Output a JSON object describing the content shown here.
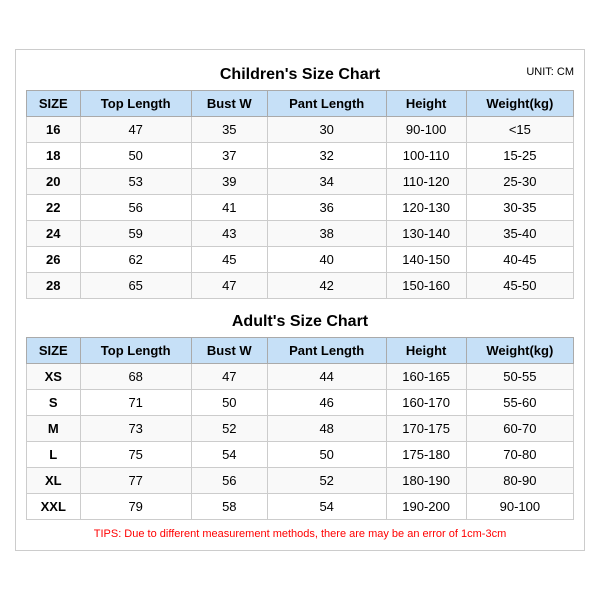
{
  "children_title": "Children's Size Chart",
  "adult_title": "Adult's Size Chart",
  "unit_label": "UNIT: CM",
  "columns": [
    "SIZE",
    "Top Length",
    "Bust W",
    "Pant Length",
    "Height",
    "Weight(kg)"
  ],
  "children_rows": [
    [
      "16",
      "47",
      "35",
      "30",
      "90-100",
      "<15"
    ],
    [
      "18",
      "50",
      "37",
      "32",
      "100-110",
      "15-25"
    ],
    [
      "20",
      "53",
      "39",
      "34",
      "110-120",
      "25-30"
    ],
    [
      "22",
      "56",
      "41",
      "36",
      "120-130",
      "30-35"
    ],
    [
      "24",
      "59",
      "43",
      "38",
      "130-140",
      "35-40"
    ],
    [
      "26",
      "62",
      "45",
      "40",
      "140-150",
      "40-45"
    ],
    [
      "28",
      "65",
      "47",
      "42",
      "150-160",
      "45-50"
    ]
  ],
  "adult_rows": [
    [
      "XS",
      "68",
      "47",
      "44",
      "160-165",
      "50-55"
    ],
    [
      "S",
      "71",
      "50",
      "46",
      "160-170",
      "55-60"
    ],
    [
      "M",
      "73",
      "52",
      "48",
      "170-175",
      "60-70"
    ],
    [
      "L",
      "75",
      "54",
      "50",
      "175-180",
      "70-80"
    ],
    [
      "XL",
      "77",
      "56",
      "52",
      "180-190",
      "80-90"
    ],
    [
      "XXL",
      "79",
      "58",
      "54",
      "190-200",
      "90-100"
    ]
  ],
  "tips": "TIPS: Due to different measurement methods, there are may be an error of 1cm-3cm"
}
